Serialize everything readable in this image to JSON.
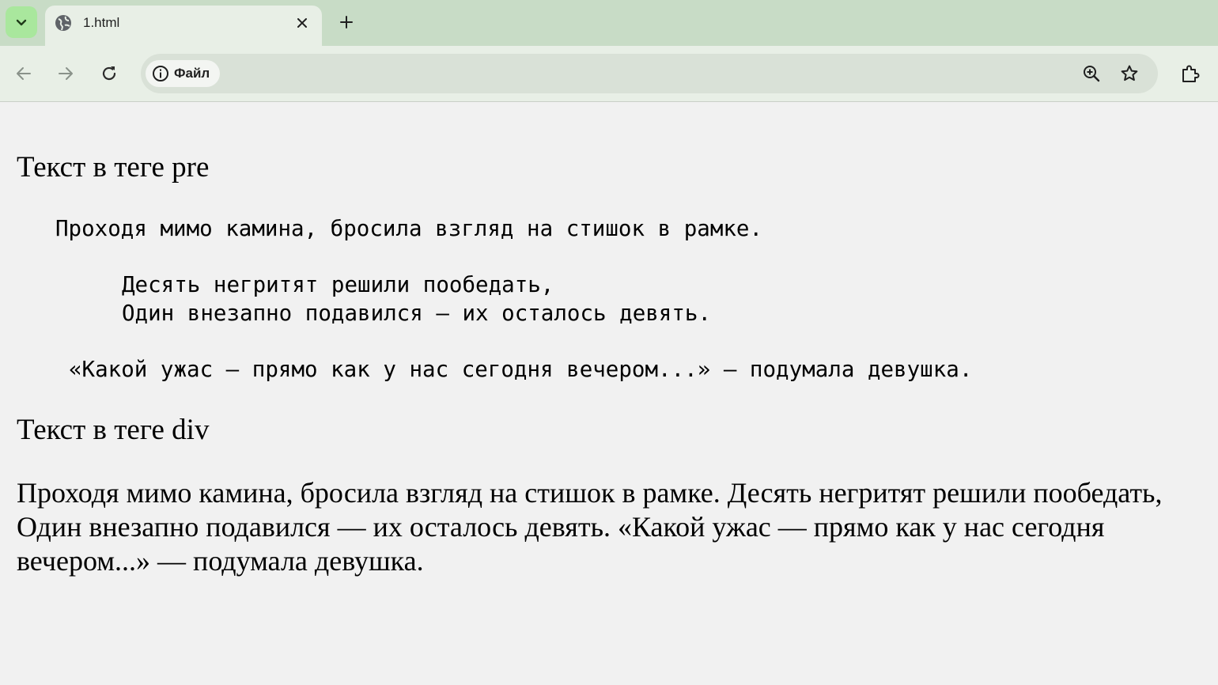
{
  "browser": {
    "tab": {
      "title": "1.html",
      "favicon": "globe-icon"
    },
    "toolbar": {
      "site_chip_label": "Файл",
      "site_chip_icon": "info-icon"
    },
    "accent_color": "#a9e79d",
    "tabstrip_color": "#c8dcc6"
  },
  "page": {
    "pre_heading": "Текст в теге pre",
    "pre_lines": [
      "Проходя мимо камина, бросила взгляд на стишок в рамке.",
      "Десять негритят решили пообедать,",
      "Один внезапно подавился — их осталось девять.",
      "«Какой ужас — прямо как у нас сегодня вечером...» — подумала девушка."
    ],
    "div_heading": "Текст в теге div",
    "div_text": "Проходя мимо камина, бросила взгляд на стишок в рамке. Десять негритят решили пообедать, Один внезапно подавился — их осталось девять. «Какой ужас — прямо как у нас сегодня вечером...» — подумала девушка."
  }
}
